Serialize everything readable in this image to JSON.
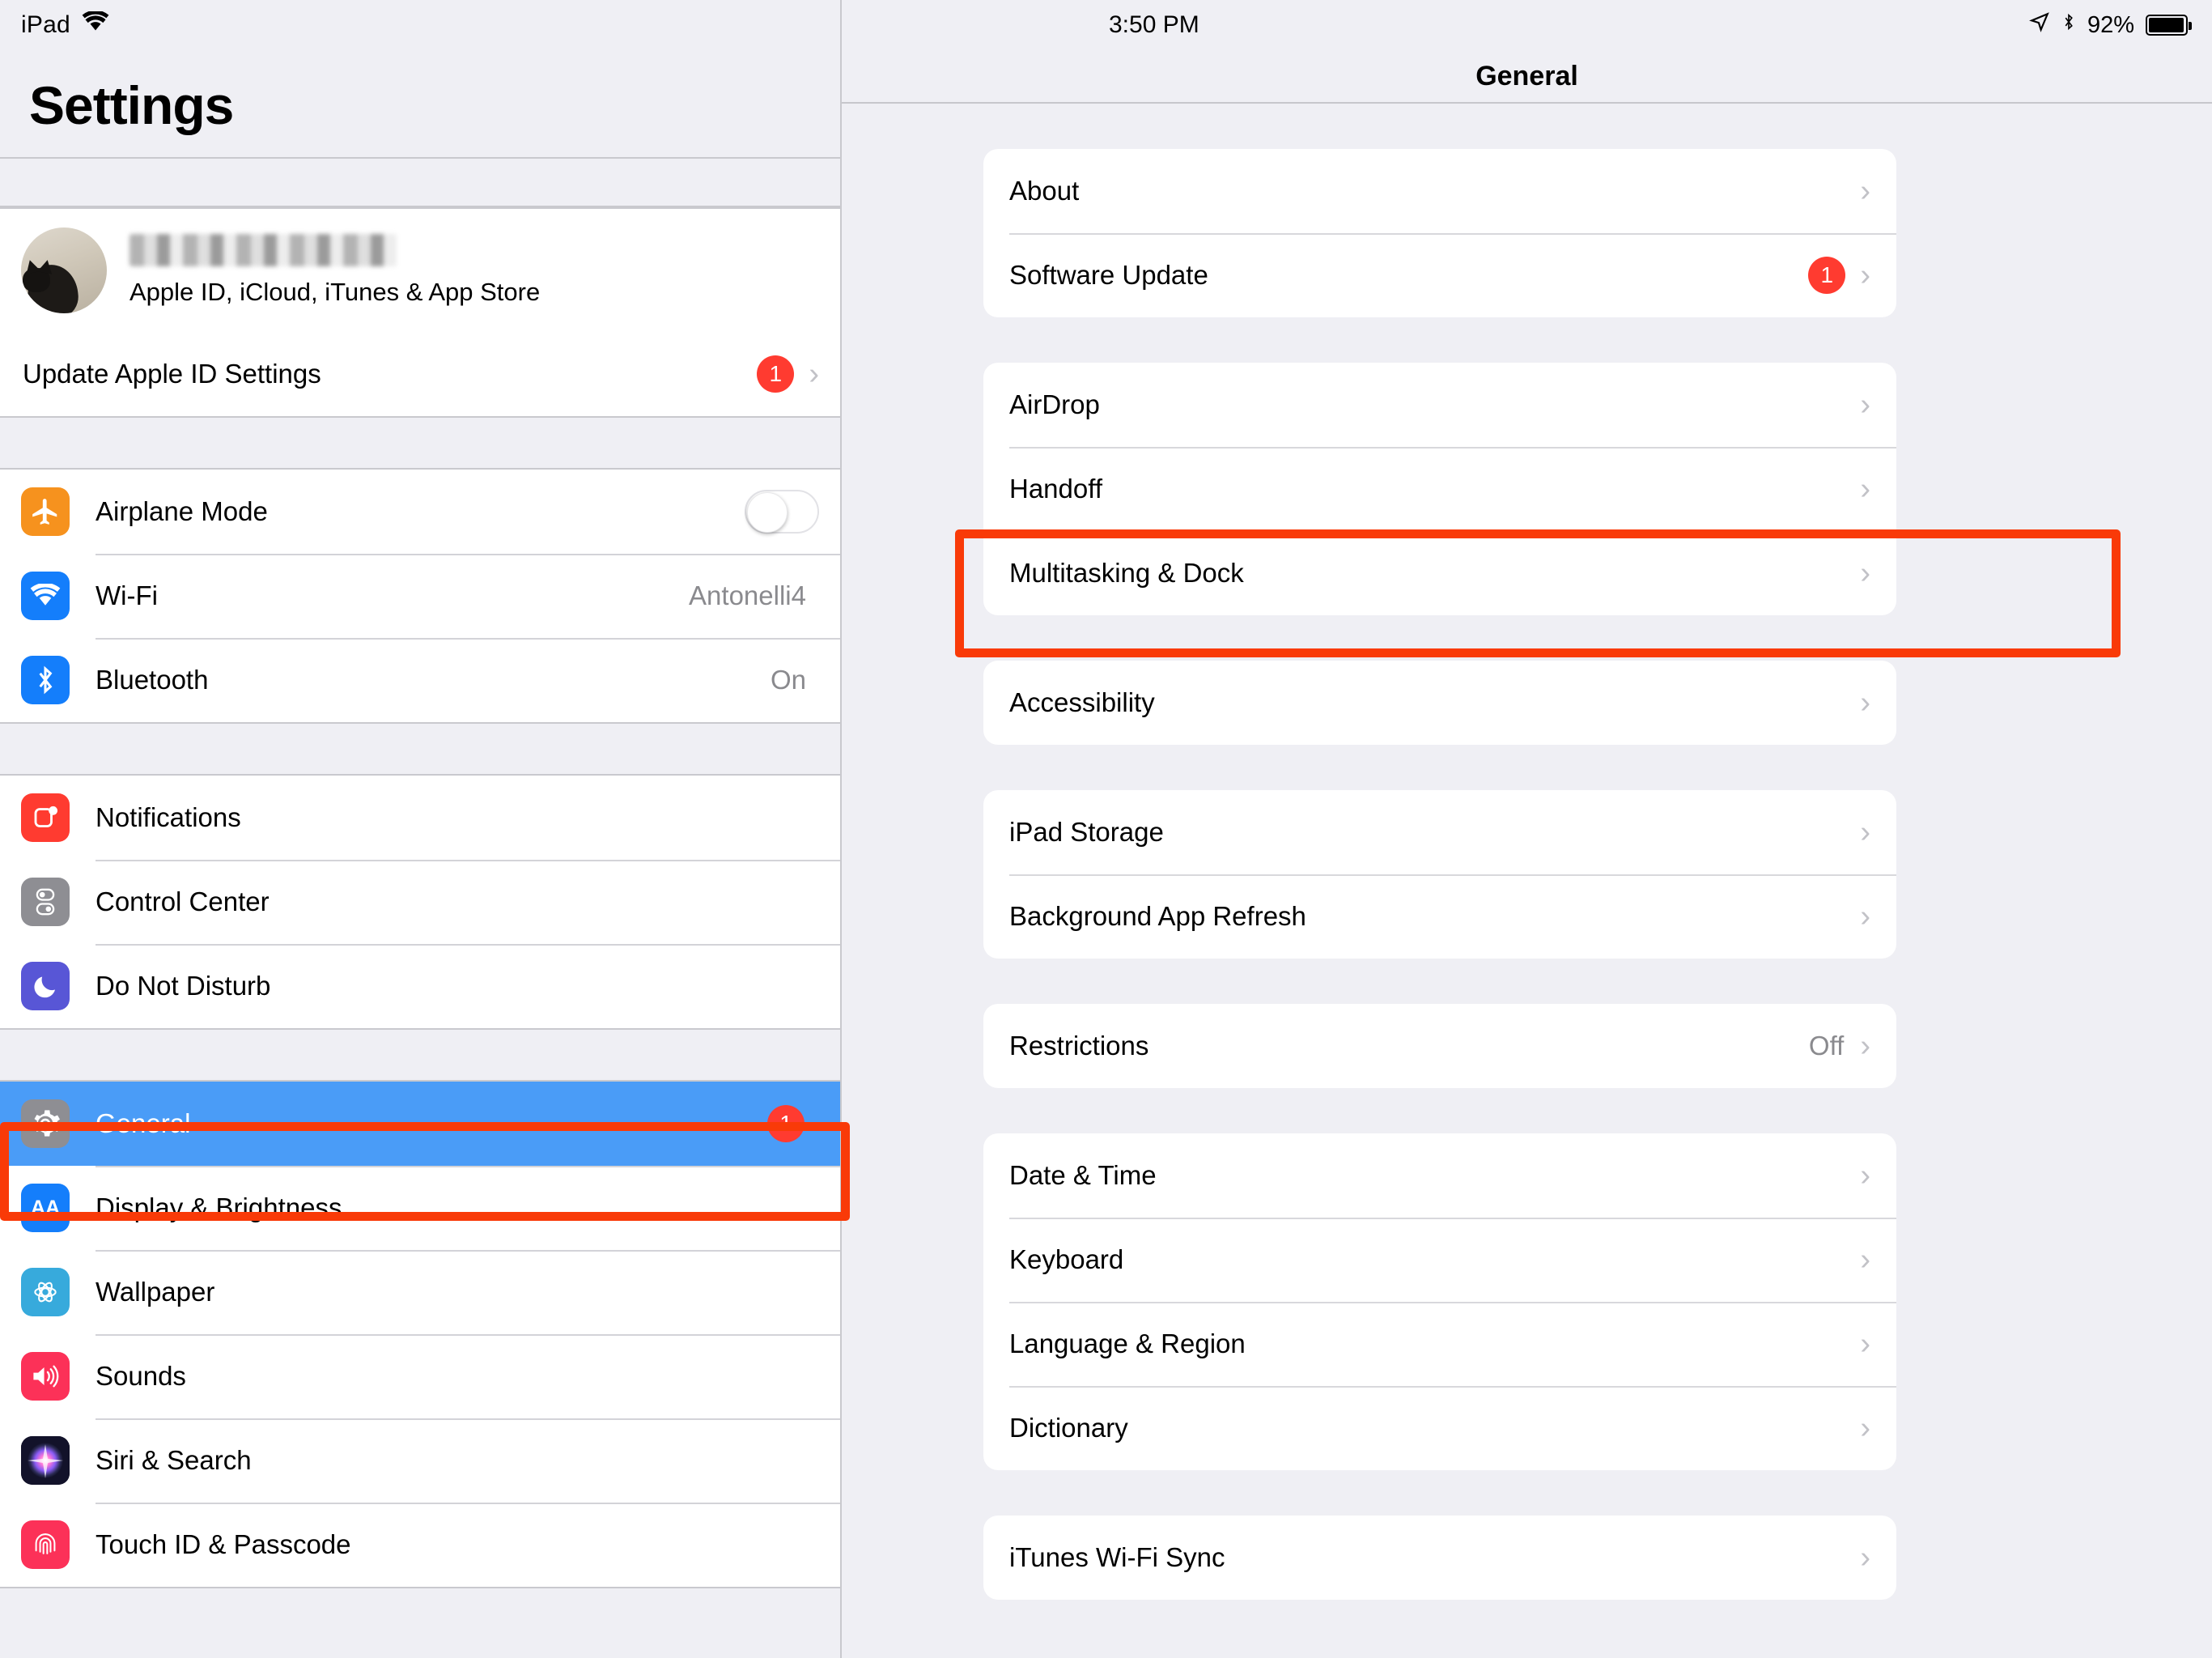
{
  "status_bar": {
    "device_label": "iPad",
    "wifi_icon": "wifi-icon",
    "time": "3:50 PM",
    "location_icon": "location-arrow-icon",
    "bluetooth_icon": "bluetooth-icon",
    "battery_percent": "92%"
  },
  "sidebar": {
    "title": "Settings",
    "account": {
      "name_blurred": "",
      "subtitle": "Apple ID, iCloud, iTunes & App Store",
      "avatar_icon": "cat-avatar"
    },
    "update_row": {
      "label": "Update Apple ID Settings",
      "badge": "1"
    },
    "group_connectivity": [
      {
        "label": "Airplane Mode",
        "icon": "airplane-icon",
        "icon_color": "#F6921E",
        "control": "toggle",
        "toggle_on": false
      },
      {
        "label": "Wi-Fi",
        "icon": "wifi-icon",
        "icon_color": "#147EFB",
        "value": "Antonelli4"
      },
      {
        "label": "Bluetooth",
        "icon": "bluetooth-icon",
        "icon_color": "#147EFB",
        "value": "On"
      }
    ],
    "group_system": [
      {
        "label": "Notifications",
        "icon": "notifications-icon",
        "icon_color": "#FF3B30"
      },
      {
        "label": "Control Center",
        "icon": "control-center-icon",
        "icon_color": "#8E8E93"
      },
      {
        "label": "Do Not Disturb",
        "icon": "moon-icon",
        "icon_color": "#5856D6"
      }
    ],
    "group_general": [
      {
        "label": "General",
        "icon": "gear-icon",
        "icon_color": "#8E8E93",
        "badge": "1",
        "selected": true
      },
      {
        "label": "Display & Brightness",
        "icon": "display-brightness-icon",
        "icon_color": "#147EFB"
      },
      {
        "label": "Wallpaper",
        "icon": "wallpaper-icon",
        "icon_color": "#37AADC"
      },
      {
        "label": "Sounds",
        "icon": "speaker-icon",
        "icon_color": "#FC3158"
      },
      {
        "label": "Siri & Search",
        "icon": "siri-icon",
        "icon_color": "#1B1B2E"
      },
      {
        "label": "Touch ID & Passcode",
        "icon": "fingerprint-icon",
        "icon_color": "#FC3158"
      }
    ]
  },
  "main": {
    "nav_title": "General",
    "groups": [
      {
        "rows": [
          {
            "label": "About"
          },
          {
            "label": "Software Update",
            "badge": "1"
          }
        ]
      },
      {
        "rows": [
          {
            "label": "AirDrop"
          },
          {
            "label": "Handoff"
          },
          {
            "label": "Multitasking & Dock",
            "highlighted": true
          }
        ]
      },
      {
        "rows": [
          {
            "label": "Accessibility"
          }
        ]
      },
      {
        "rows": [
          {
            "label": "iPad Storage"
          },
          {
            "label": "Background App Refresh"
          }
        ]
      },
      {
        "rows": [
          {
            "label": "Restrictions",
            "value": "Off"
          }
        ]
      },
      {
        "rows": [
          {
            "label": "Date & Time"
          },
          {
            "label": "Keyboard"
          },
          {
            "label": "Language & Region"
          },
          {
            "label": "Dictionary"
          }
        ]
      },
      {
        "rows": [
          {
            "label": "iTunes Wi-Fi Sync"
          }
        ]
      }
    ]
  },
  "annotations": {
    "highlight_color": "#F93A08",
    "targets": [
      "General",
      "Multitasking & Dock"
    ]
  }
}
